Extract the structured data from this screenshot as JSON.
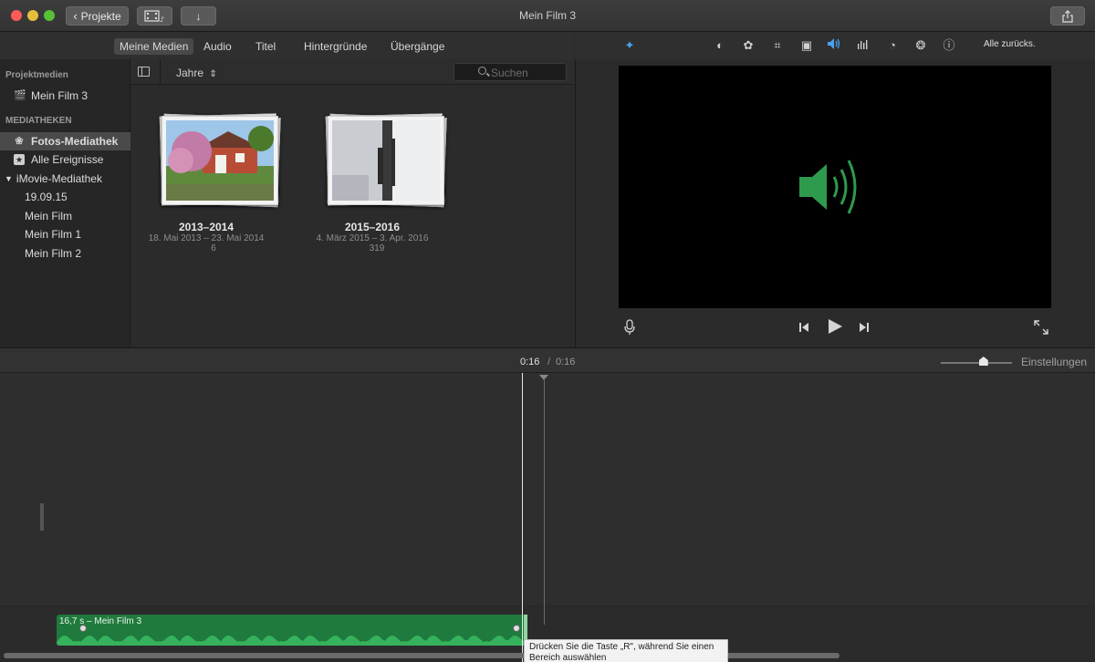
{
  "window": {
    "title": "Mein Film 3"
  },
  "titlebar": {
    "back_label": "Projekte"
  },
  "tabs": [
    {
      "label": "Meine Medien",
      "active": true
    },
    {
      "label": "Audio",
      "active": false
    },
    {
      "label": "Titel",
      "active": false
    },
    {
      "label": "Hintergründe",
      "active": false
    },
    {
      "label": "Übergänge",
      "active": false
    }
  ],
  "sidebar": {
    "section_project": "Projektmedien",
    "project_item": "Mein Film 3",
    "section_libraries": "MEDIATHEKEN",
    "items": [
      {
        "label": "Fotos-Mediathek",
        "icon": "photos-icon",
        "selected": true
      },
      {
        "label": "Alle Ereignisse",
        "icon": "star-icon",
        "selected": false
      }
    ],
    "library": "iMovie-Mediathek",
    "library_items": [
      "19.09.15",
      "Mein Film",
      "Mein Film 1",
      "Mein Film 2"
    ]
  },
  "browser": {
    "sort_label": "Jahre",
    "search_placeholder": "Suchen",
    "events": [
      {
        "title": "2013–2014",
        "dates": "18. Mai 2013 – 23. Mai 2014",
        "count": "6"
      },
      {
        "title": "2015–2016",
        "dates": "4. März 2015 – 3. Apr. 2016",
        "count": "319"
      }
    ]
  },
  "viewer": {
    "reset_label": "Alle zurücks.",
    "speaker_color": "#2e9a4e",
    "active_tool_color": "#4aa3f0"
  },
  "timeline": {
    "current_time": "0:16",
    "separator": "/",
    "total_time": "0:16",
    "settings_label": "Einstellungen",
    "zoom_level": 0.6,
    "clip_label": "16,7 s – Mein Film 3",
    "tooltip": "Drücken Sie die Taste „R\", während Sie einen Bereich auswählen"
  }
}
